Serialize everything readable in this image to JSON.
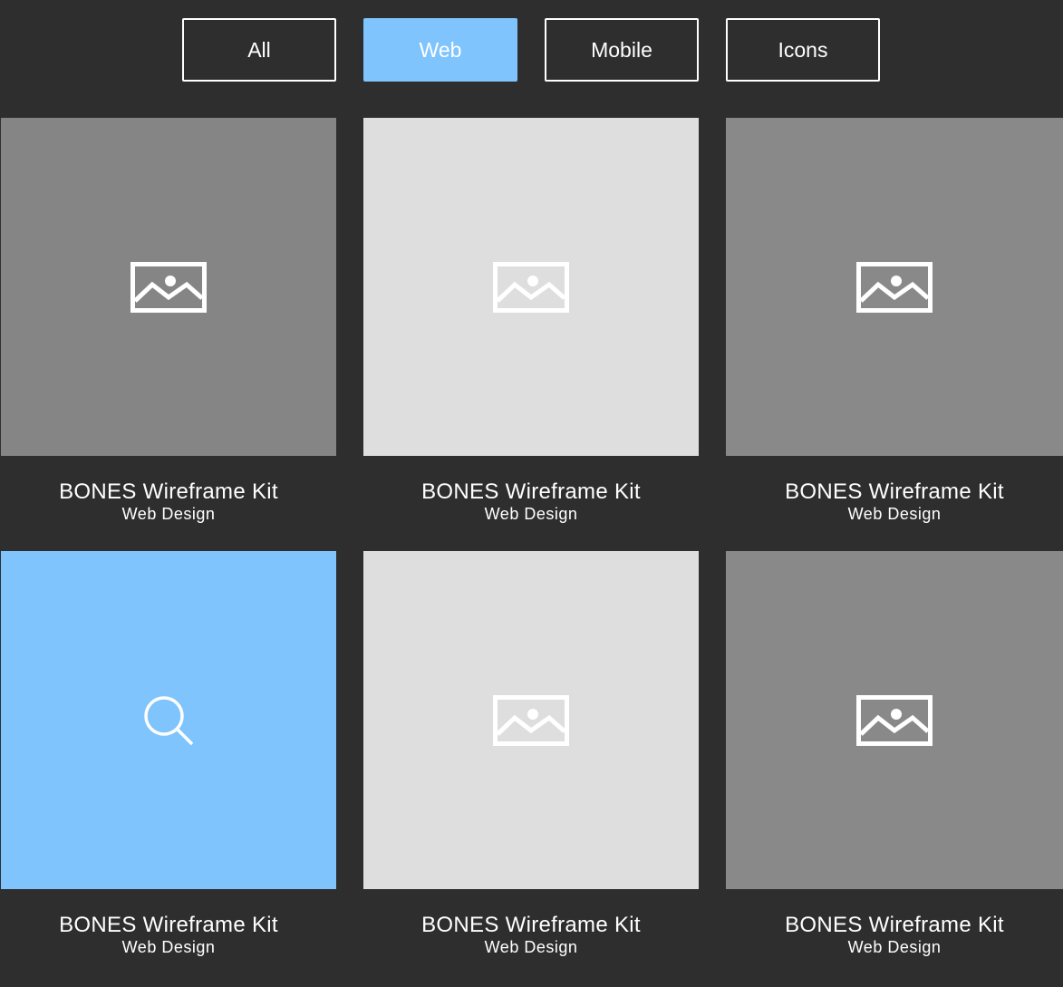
{
  "filters": [
    {
      "label": "All",
      "active": false
    },
    {
      "label": "Web",
      "active": true
    },
    {
      "label": "Mobile",
      "active": false
    },
    {
      "label": "Icons",
      "active": false
    }
  ],
  "colors": {
    "background": "#2e2e2e",
    "accent": "#7fc4fd",
    "thumb_dark": "#858585",
    "thumb_light": "#dedede",
    "text": "#ffffff"
  },
  "portfolio": {
    "items": [
      {
        "title": "BONES Wireframe Kit",
        "category": "Web Design",
        "icon": "image-placeholder-icon",
        "state": "default"
      },
      {
        "title": "BONES Wireframe Kit",
        "category": "Web Design",
        "icon": "image-placeholder-icon",
        "state": "default"
      },
      {
        "title": "BONES Wireframe Kit",
        "category": "Web Design",
        "icon": "image-placeholder-icon",
        "state": "default"
      },
      {
        "title": "BONES Wireframe Kit",
        "category": "Web Design",
        "icon": "search-icon",
        "state": "hover"
      },
      {
        "title": "BONES Wireframe Kit",
        "category": "Web Design",
        "icon": "image-placeholder-icon",
        "state": "default"
      },
      {
        "title": "BONES Wireframe Kit",
        "category": "Web Design",
        "icon": "image-placeholder-icon",
        "state": "default"
      }
    ]
  }
}
